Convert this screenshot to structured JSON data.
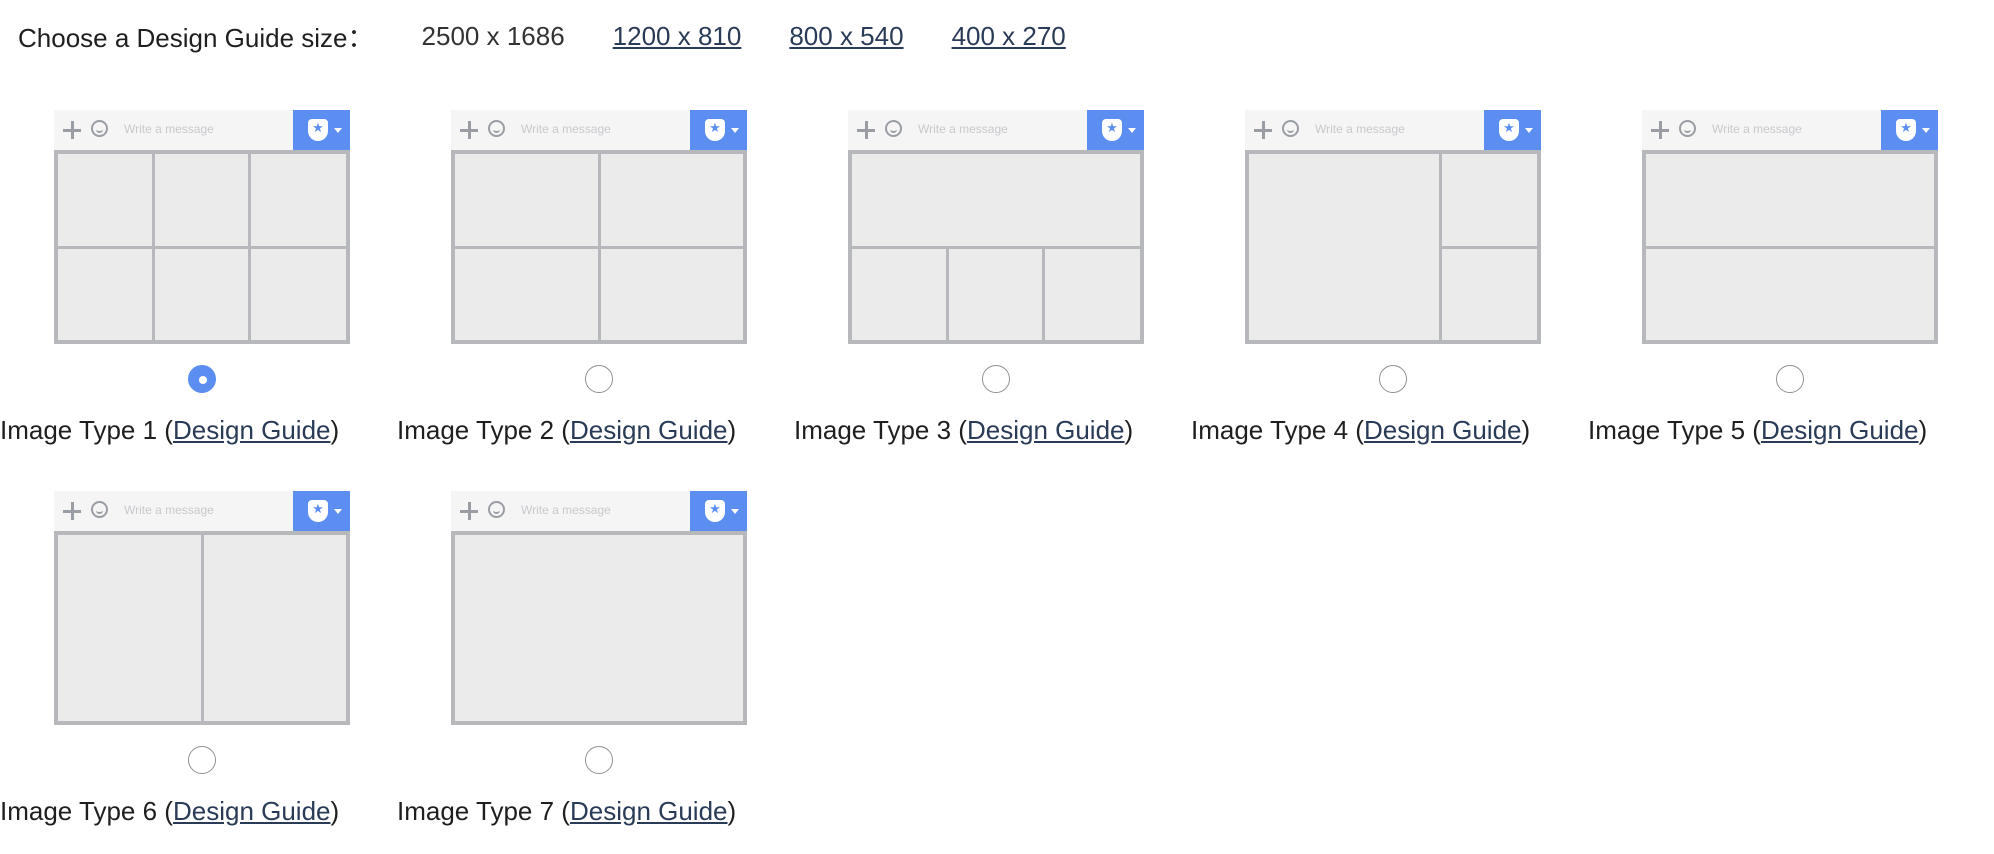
{
  "header": {
    "label": "Choose a Design Guide size：",
    "sizes": [
      "2500 x 1686",
      "1200 x 810",
      "800 x 540",
      "400 x 270"
    ]
  },
  "thumbnail": {
    "message_placeholder": "Write a message",
    "icons": [
      "plus-icon",
      "smile-icon",
      "shield-star-icon",
      "caret-down-icon"
    ]
  },
  "types": [
    {
      "name": "Image Type 1",
      "link": "Design Guide",
      "selected": true
    },
    {
      "name": "Image Type 2",
      "link": "Design Guide",
      "selected": false
    },
    {
      "name": "Image Type 3",
      "link": "Design Guide",
      "selected": false
    },
    {
      "name": "Image Type 4",
      "link": "Design Guide",
      "selected": false
    },
    {
      "name": "Image Type 5",
      "link": "Design Guide",
      "selected": false
    },
    {
      "name": "Image Type 6",
      "link": "Design Guide",
      "selected": false
    },
    {
      "name": "Image Type 7",
      "link": "Design Guide",
      "selected": false
    }
  ],
  "colors": {
    "accent": "#5b8ef0",
    "link": "#2a3b57",
    "panel": "#ebebec",
    "divider": "#b7b8bb"
  }
}
